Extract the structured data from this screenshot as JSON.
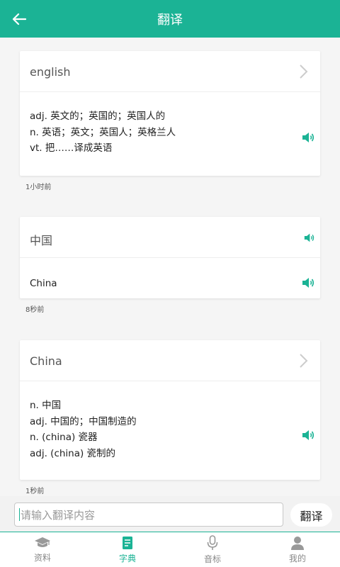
{
  "header": {
    "title": "翻译"
  },
  "records": [
    {
      "word": "english",
      "definitions": [
        "adj. 英文的；英国的；英国人的",
        "n. 英语；英文；英国人；英格兰人",
        "vt. 把……译成英语"
      ],
      "time": "1小时前"
    },
    {
      "word": "中国",
      "definitions": [
        "China"
      ],
      "time": "8秒前"
    },
    {
      "word": "China",
      "definitions": [
        "n. 中国",
        "adj. 中国的；中国制造的",
        "n. (china) 瓷器",
        "adj. (china) 瓷制的"
      ],
      "time": "1秒前"
    }
  ],
  "input": {
    "placeholder": "请输入翻译内容",
    "button_label": "翻译"
  },
  "tabs": [
    {
      "label": "资料",
      "icon": "graduation-cap-icon"
    },
    {
      "label": "字典",
      "icon": "document-icon"
    },
    {
      "label": "音标",
      "icon": "microphone-icon"
    },
    {
      "label": "我的",
      "icon": "user-icon"
    }
  ],
  "active_tab": "字典",
  "colors": {
    "accent": "#1bb395",
    "background": "#f5f5f5"
  }
}
